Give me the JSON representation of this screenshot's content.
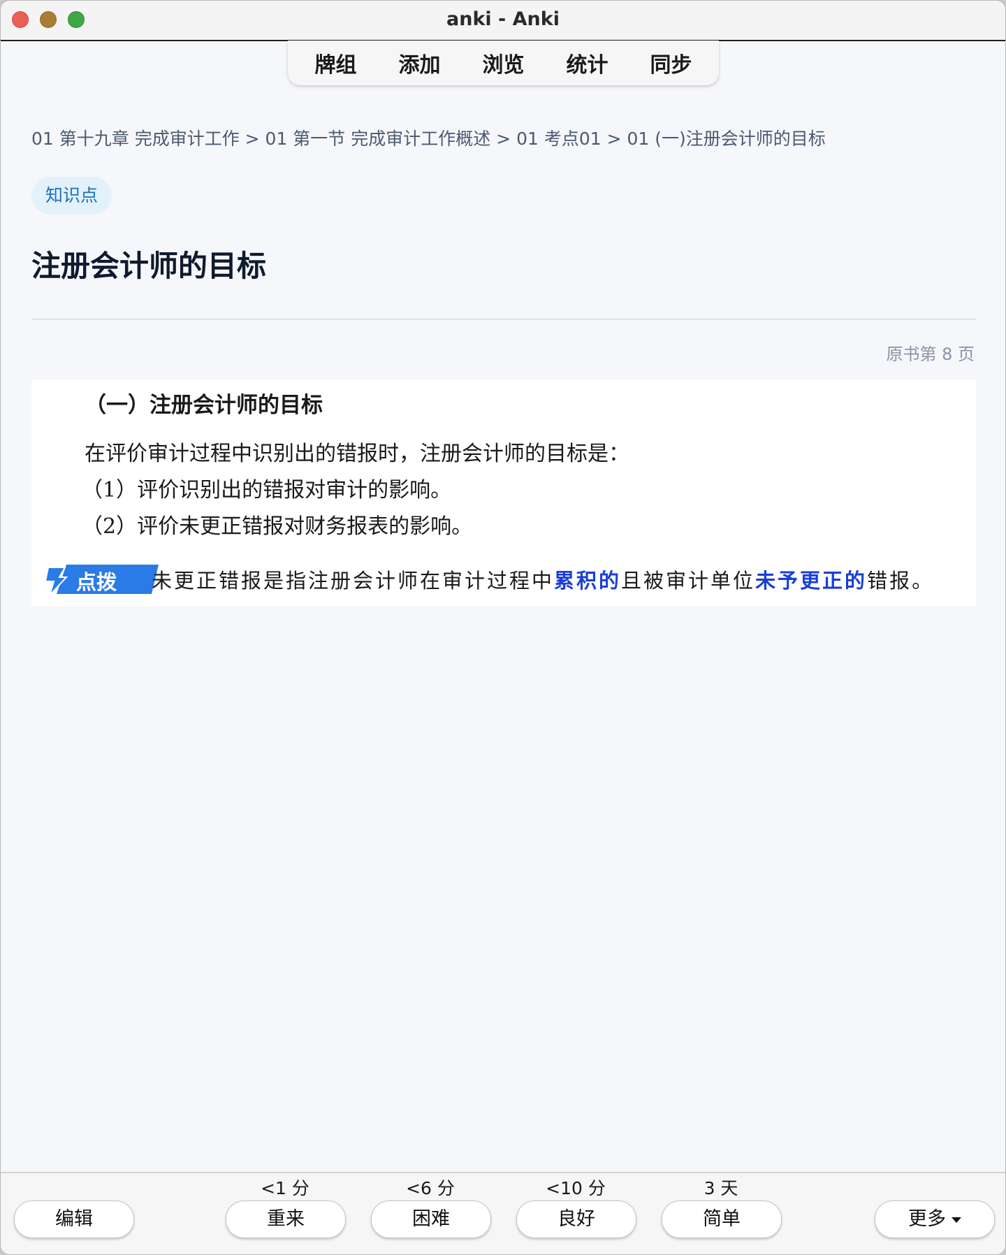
{
  "window": {
    "title": "anki - Anki"
  },
  "toolbar": {
    "items": [
      "牌组",
      "添加",
      "浏览",
      "统计",
      "同步"
    ]
  },
  "card": {
    "breadcrumb": "01 第十九章 完成审计工作 > 01 第一节 完成审计工作概述 > 01 考点01 > 01 (一)注册会计师的目标",
    "tag": "知识点",
    "title": "注册会计师的目标",
    "page_ref": "原书第 8 页",
    "excerpt": {
      "heading": "（一）注册会计师的目标",
      "line1": "在评价审计过程中识别出的错报时，注册会计师的目标是：",
      "line2": "（1）评价识别出的错报对审计的影响。",
      "line3": "（2）评价未更正错报对财务报表的影响。",
      "tip_label": "点拨",
      "tip_text_1": "未更正错报是指注册会计师在审计过程中",
      "tip_hl_1": "累积的",
      "tip_text_2": "且被审计单位",
      "tip_hl_2": "未予更正的",
      "tip_text_3": "错报。"
    }
  },
  "answer_bar": {
    "edit_label": "编辑",
    "intervals": {
      "again": "<1 分",
      "hard": "<6 分",
      "good": "<10 分",
      "easy": "3 天"
    },
    "again_label": "重来",
    "hard_label": "困难",
    "good_label": "良好",
    "easy_label": "简单",
    "more_label": "更多"
  },
  "colors": {
    "accent_blue": "#1a3fd6",
    "tag_bg": "#e3f1fb",
    "tag_text": "#1b6fb8"
  }
}
